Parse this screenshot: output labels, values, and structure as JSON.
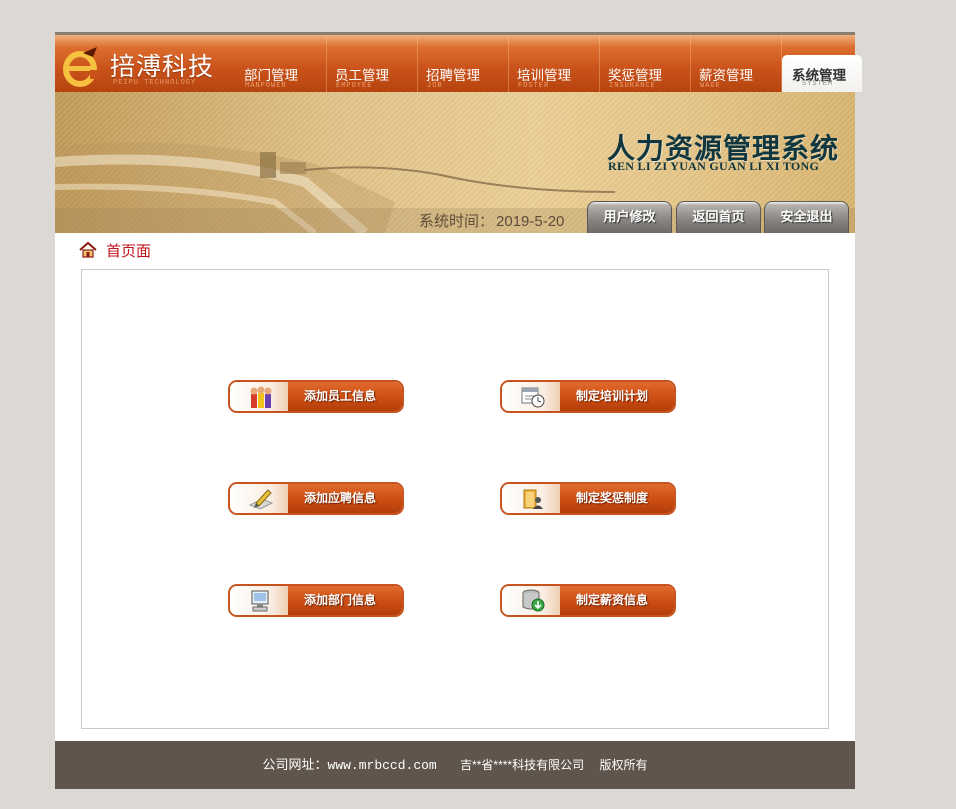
{
  "app": {
    "logo_text": "掊溥科技",
    "logo_sub": "PEIPU TECHNOLOGY"
  },
  "nav": {
    "items": [
      {
        "cn": "部门管理",
        "en": "MANPOWER"
      },
      {
        "cn": "员工管理",
        "en": "EMPOYEE"
      },
      {
        "cn": "招聘管理",
        "en": "JOB"
      },
      {
        "cn": "培训管理",
        "en": "FOSTER"
      },
      {
        "cn": "奖惩管理",
        "en": "INSURANCE"
      },
      {
        "cn": "薪资管理",
        "en": "WAGE"
      },
      {
        "cn": "系统管理",
        "en": "SYSTEM"
      }
    ],
    "active_index": 6
  },
  "banner": {
    "title": "人力资源管理系统",
    "pinyin": "REN LI ZI YUAN GUAN LI XI TONG",
    "time_label": "系统时间：",
    "time_value": "2019-5-20",
    "buttons": {
      "user_edit": "用户修改",
      "back_home": "返回首页",
      "logout": "安全退出"
    }
  },
  "breadcrumb": {
    "label": "首页面",
    "icon": "home-icon"
  },
  "quick_actions": {
    "add_employee": {
      "label": "添加员工信息",
      "icon": "people-icon"
    },
    "training_plan": {
      "label": "制定培训计划",
      "icon": "calendar-clock-icon"
    },
    "add_recruit": {
      "label": "添加应聘信息",
      "icon": "pen-paper-icon"
    },
    "reward_policy": {
      "label": "制定奖惩制度",
      "icon": "folder-user-icon"
    },
    "add_department": {
      "label": "添加部门信息",
      "icon": "computer-icon"
    },
    "salary_info": {
      "label": "制定薪资信息",
      "icon": "database-download-icon"
    }
  },
  "footer": {
    "site": "公司网址：www.mrbccd.com",
    "company": "吉**省****科技有限公司",
    "rights": "版权所有"
  },
  "colors": {
    "nav_orange": "#c9521a",
    "button_orange": "#cc4d12",
    "title_teal": "#10363f",
    "breadcrumb_red": "#c0121b",
    "footer_bg": "#5f554c",
    "page_bg": "#dcd8d3"
  }
}
